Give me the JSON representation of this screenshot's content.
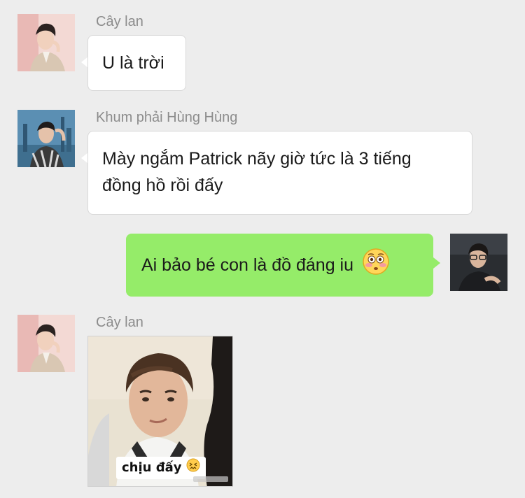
{
  "messages": [
    {
      "sender": "Cây lan",
      "text": "U là trời",
      "direction": "incoming",
      "avatar": "avatar-cay-lan"
    },
    {
      "sender": "Khum phải Hùng Hùng",
      "text_line1": "Mày ngắm Patrick nãy giờ tức là 3 tiếng",
      "text_line2": "đồng hồ rồi đấy",
      "direction": "incoming",
      "avatar": "avatar-khum-phai-hung-hung"
    },
    {
      "text": "Ai bảo bé con là đồ đáng iu",
      "emoji": "flushed-face-emoji",
      "direction": "outgoing",
      "avatar": "avatar-self"
    },
    {
      "sender": "Cây lan",
      "sticker_caption": "chịu đấy",
      "sticker_emoji": "confounded-face-emoji",
      "direction": "incoming",
      "avatar": "avatar-cay-lan"
    }
  ],
  "colors": {
    "background": "#ededed",
    "incoming_bubble": "#ffffff",
    "outgoing_bubble": "#95ec69",
    "sender_name": "#8c8c8c"
  }
}
